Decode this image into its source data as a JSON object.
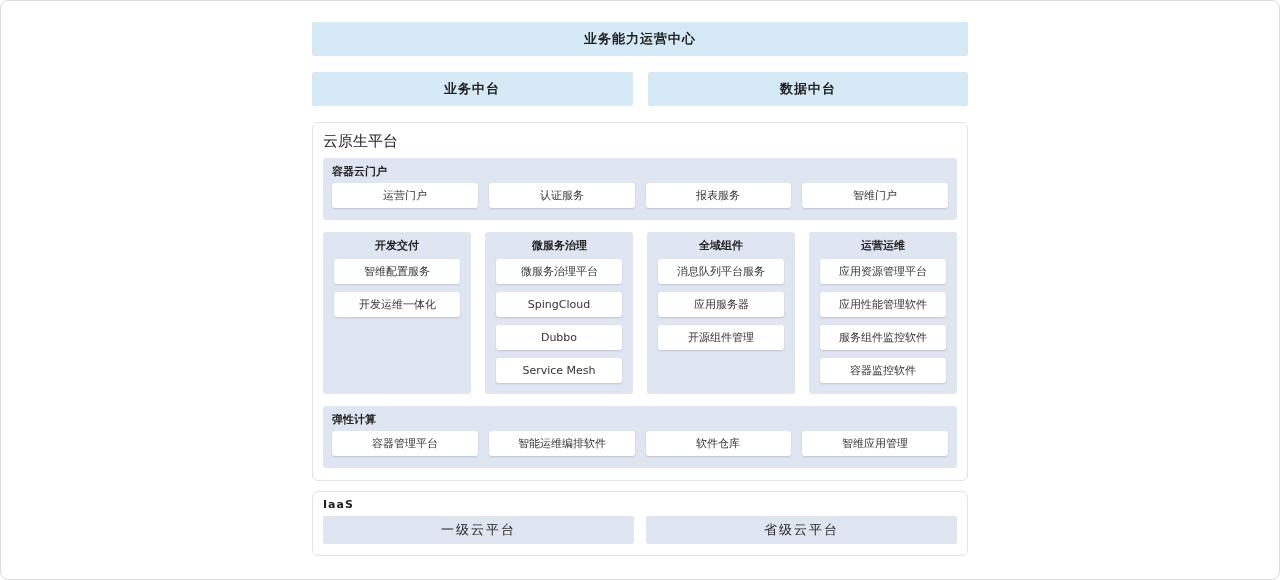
{
  "top_bar": {
    "title": "业务能力运营中心"
  },
  "middle_platforms": [
    {
      "title": "业务中台"
    },
    {
      "title": "数据中台"
    }
  ],
  "cloud_native": {
    "title": "云原生平台",
    "container_portal": {
      "title": "容器云门户",
      "items": [
        "运营门户",
        "认证服务",
        "报表服务",
        "智维门户"
      ]
    },
    "columns": [
      {
        "title": "开发交付",
        "items": [
          "智维配置服务",
          "开发运维一体化"
        ]
      },
      {
        "title": "微服务治理",
        "items": [
          "微服务治理平台",
          "SpingCloud",
          "Dubbo",
          "Service Mesh"
        ]
      },
      {
        "title": "全域组件",
        "items": [
          "消息队列平台服务",
          "应用服务器",
          "开源组件管理"
        ]
      },
      {
        "title": "运营运维",
        "items": [
          "应用资源管理平台",
          "应用性能管理软件",
          "服务组件监控软件",
          "容器监控软件"
        ]
      }
    ],
    "elastic_computing": {
      "title": "弹性计算",
      "items": [
        "容器管理平台",
        "智能运维编排软件",
        "软件仓库",
        "智维应用管理"
      ]
    }
  },
  "iaas": {
    "title": "IaaS",
    "items": [
      "一级云平台",
      "省级云平台"
    ]
  }
}
